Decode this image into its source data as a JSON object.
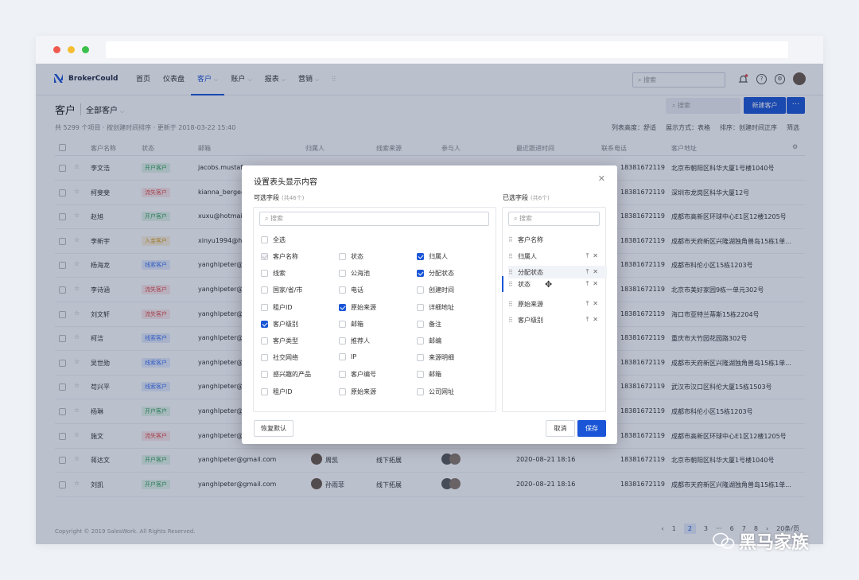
{
  "nav": {
    "brand": "BrokerCould",
    "items": [
      "首页",
      "仪表盘",
      "客户",
      "账户",
      "报表",
      "营销"
    ],
    "search_placeholder": "搜索",
    "help": "?"
  },
  "page": {
    "title": "客户",
    "view": "全部客户",
    "info": "共 5299 个项目 · 按创建时间排序 · 更新于 2018-03-22 15:40",
    "opts": [
      "列表高度：舒适",
      "展示方式：表格",
      "排序：创建时间正序",
      "筛选"
    ],
    "search_placeholder": "搜索",
    "new_button": "新建客户",
    "more": "···"
  },
  "table": {
    "headers": [
      "客户名称",
      "状态",
      "邮箱",
      "归属人",
      "线索来源",
      "参与人",
      "最近跟进时间",
      "联系电话",
      "客户地址"
    ],
    "rows": [
      {
        "name": "李文浩",
        "status": "开户客户",
        "st": "g",
        "email": "jacobs.mustafa",
        "phone": "18381672119",
        "addr": "北京市朝阳区科华大厦1号楼1040号"
      },
      {
        "name": "柯斐斐",
        "status": "流失客户",
        "st": "r",
        "email": "kianna_berge@",
        "phone": "18381672119",
        "addr": "深圳市龙岗区科华大厦12号"
      },
      {
        "name": "赵旭",
        "status": "开户客户",
        "st": "g",
        "email": "xuxu@hotmail.",
        "phone": "18381672119",
        "addr": "成都市高新区环球中心E1区12楼1205号"
      },
      {
        "name": "李新宇",
        "status": "入金客户",
        "st": "y",
        "email": "xinyu1994@ho",
        "phone": "18381672119",
        "addr": "成都市天府新区兴隆湖独角兽岛15栋1单..."
      },
      {
        "name": "杨海龙",
        "status": "线索客户",
        "st": "b",
        "email": "yanghlpeter@",
        "phone": "18381672119",
        "addr": "成都市科伦小区15栋1203号"
      },
      {
        "name": "李诗涵",
        "status": "流失客户",
        "st": "r",
        "email": "yanghlpeter@",
        "phone": "18381672119",
        "addr": "北京市美好家园9栋一单元302号"
      },
      {
        "name": "刘文轩",
        "status": "流失客户",
        "st": "r",
        "email": "yanghlpeter@",
        "phone": "18381672119",
        "addr": "海口市亚特兰蒂斯15栋2204号"
      },
      {
        "name": "柯洁",
        "status": "线索客户",
        "st": "b",
        "email": "yanghlpeter@",
        "phone": "18381672119",
        "addr": "重庆市大竹园花园路302号"
      },
      {
        "name": "吴世勋",
        "status": "线索客户",
        "st": "b",
        "email": "yanghlpeter@",
        "phone": "18381672119",
        "addr": "成都市天府新区兴隆湖独角兽岛15栋1单..."
      },
      {
        "name": "苟兴平",
        "status": "线索客户",
        "st": "b",
        "email": "yanghlpeter@",
        "phone": "18381672119",
        "addr": "武汉市汉口区科伦大厦15栋1503号"
      },
      {
        "name": "杨琳",
        "status": "开户客户",
        "st": "g",
        "email": "yanghlpeter@",
        "phone": "18381672119",
        "addr": "成都市科伦小区15栋1203号"
      },
      {
        "name": "施文",
        "status": "流失客户",
        "st": "r",
        "email": "yanghlpeter@",
        "phone": "18381672119",
        "addr": "成都市高新区环球中心E1区12楼1205号"
      },
      {
        "name": "蒋达文",
        "status": "开户客户",
        "st": "g",
        "email": "yanghlpeter@gmail.com",
        "owner": "周凯",
        "source": "线下拓展",
        "time": "2020–08–21 18:16",
        "phone": "18381672119",
        "addr": "北京市朝阳区科华大厦1号楼1040号"
      },
      {
        "name": "刘凯",
        "status": "开户客户",
        "st": "g",
        "email": "yanghlpeter@gmail.com",
        "owner": "孙雨菲",
        "source": "线下拓展",
        "time": "2020–08–21 18:16",
        "phone": "18381672119",
        "addr": "成都市天府新区兴隆湖独角兽岛15栋1单..."
      }
    ]
  },
  "footer": {
    "copyright": "Copyright © 2019 SalesWork. All Rights Reserved.",
    "pages": [
      "‹",
      "1",
      "2",
      "3",
      "···",
      "6",
      "7",
      "8",
      "›"
    ],
    "page_size": "20条/页"
  },
  "modal": {
    "title": "设置表头显示内容",
    "available_label": "可选字段",
    "available_count": "(共46个)",
    "selected_label": "已选字段",
    "selected_count": "(共6个)",
    "search_placeholder": "搜索",
    "select_all": "全选",
    "fields": [
      {
        "label": "客户名称",
        "state": "dis"
      },
      {
        "label": "状态",
        "state": ""
      },
      {
        "label": "归属人",
        "state": "on"
      },
      {
        "label": "线索",
        "state": ""
      },
      {
        "label": "公海池",
        "state": ""
      },
      {
        "label": "分配状态",
        "state": "on"
      },
      {
        "label": "国家/省/市",
        "state": ""
      },
      {
        "label": "电话",
        "state": ""
      },
      {
        "label": "创建时间",
        "state": ""
      },
      {
        "label": "租户ID",
        "state": ""
      },
      {
        "label": "原始来源",
        "state": "on"
      },
      {
        "label": "详细地址",
        "state": ""
      },
      {
        "label": "客户级别",
        "state": "on"
      },
      {
        "label": "邮箱",
        "state": ""
      },
      {
        "label": "备注",
        "state": ""
      },
      {
        "label": "客户类型",
        "state": ""
      },
      {
        "label": "推荐人",
        "state": ""
      },
      {
        "label": "邮编",
        "state": ""
      },
      {
        "label": "社交网络",
        "state": ""
      },
      {
        "label": "IP",
        "state": ""
      },
      {
        "label": "来源明细",
        "state": ""
      },
      {
        "label": "感兴趣的产品",
        "state": ""
      },
      {
        "label": "客户编号",
        "state": ""
      },
      {
        "label": "邮箱",
        "state": ""
      },
      {
        "label": "租户ID",
        "state": ""
      },
      {
        "label": "原始来源",
        "state": ""
      },
      {
        "label": "公司网址",
        "state": ""
      }
    ],
    "selected": [
      "客户名称",
      "归属人",
      "分配状态",
      "状态",
      "原始来源",
      "客户级别"
    ],
    "reset": "恢复默认",
    "cancel": "取消",
    "save": "保存"
  },
  "watermark": "黑马家族"
}
